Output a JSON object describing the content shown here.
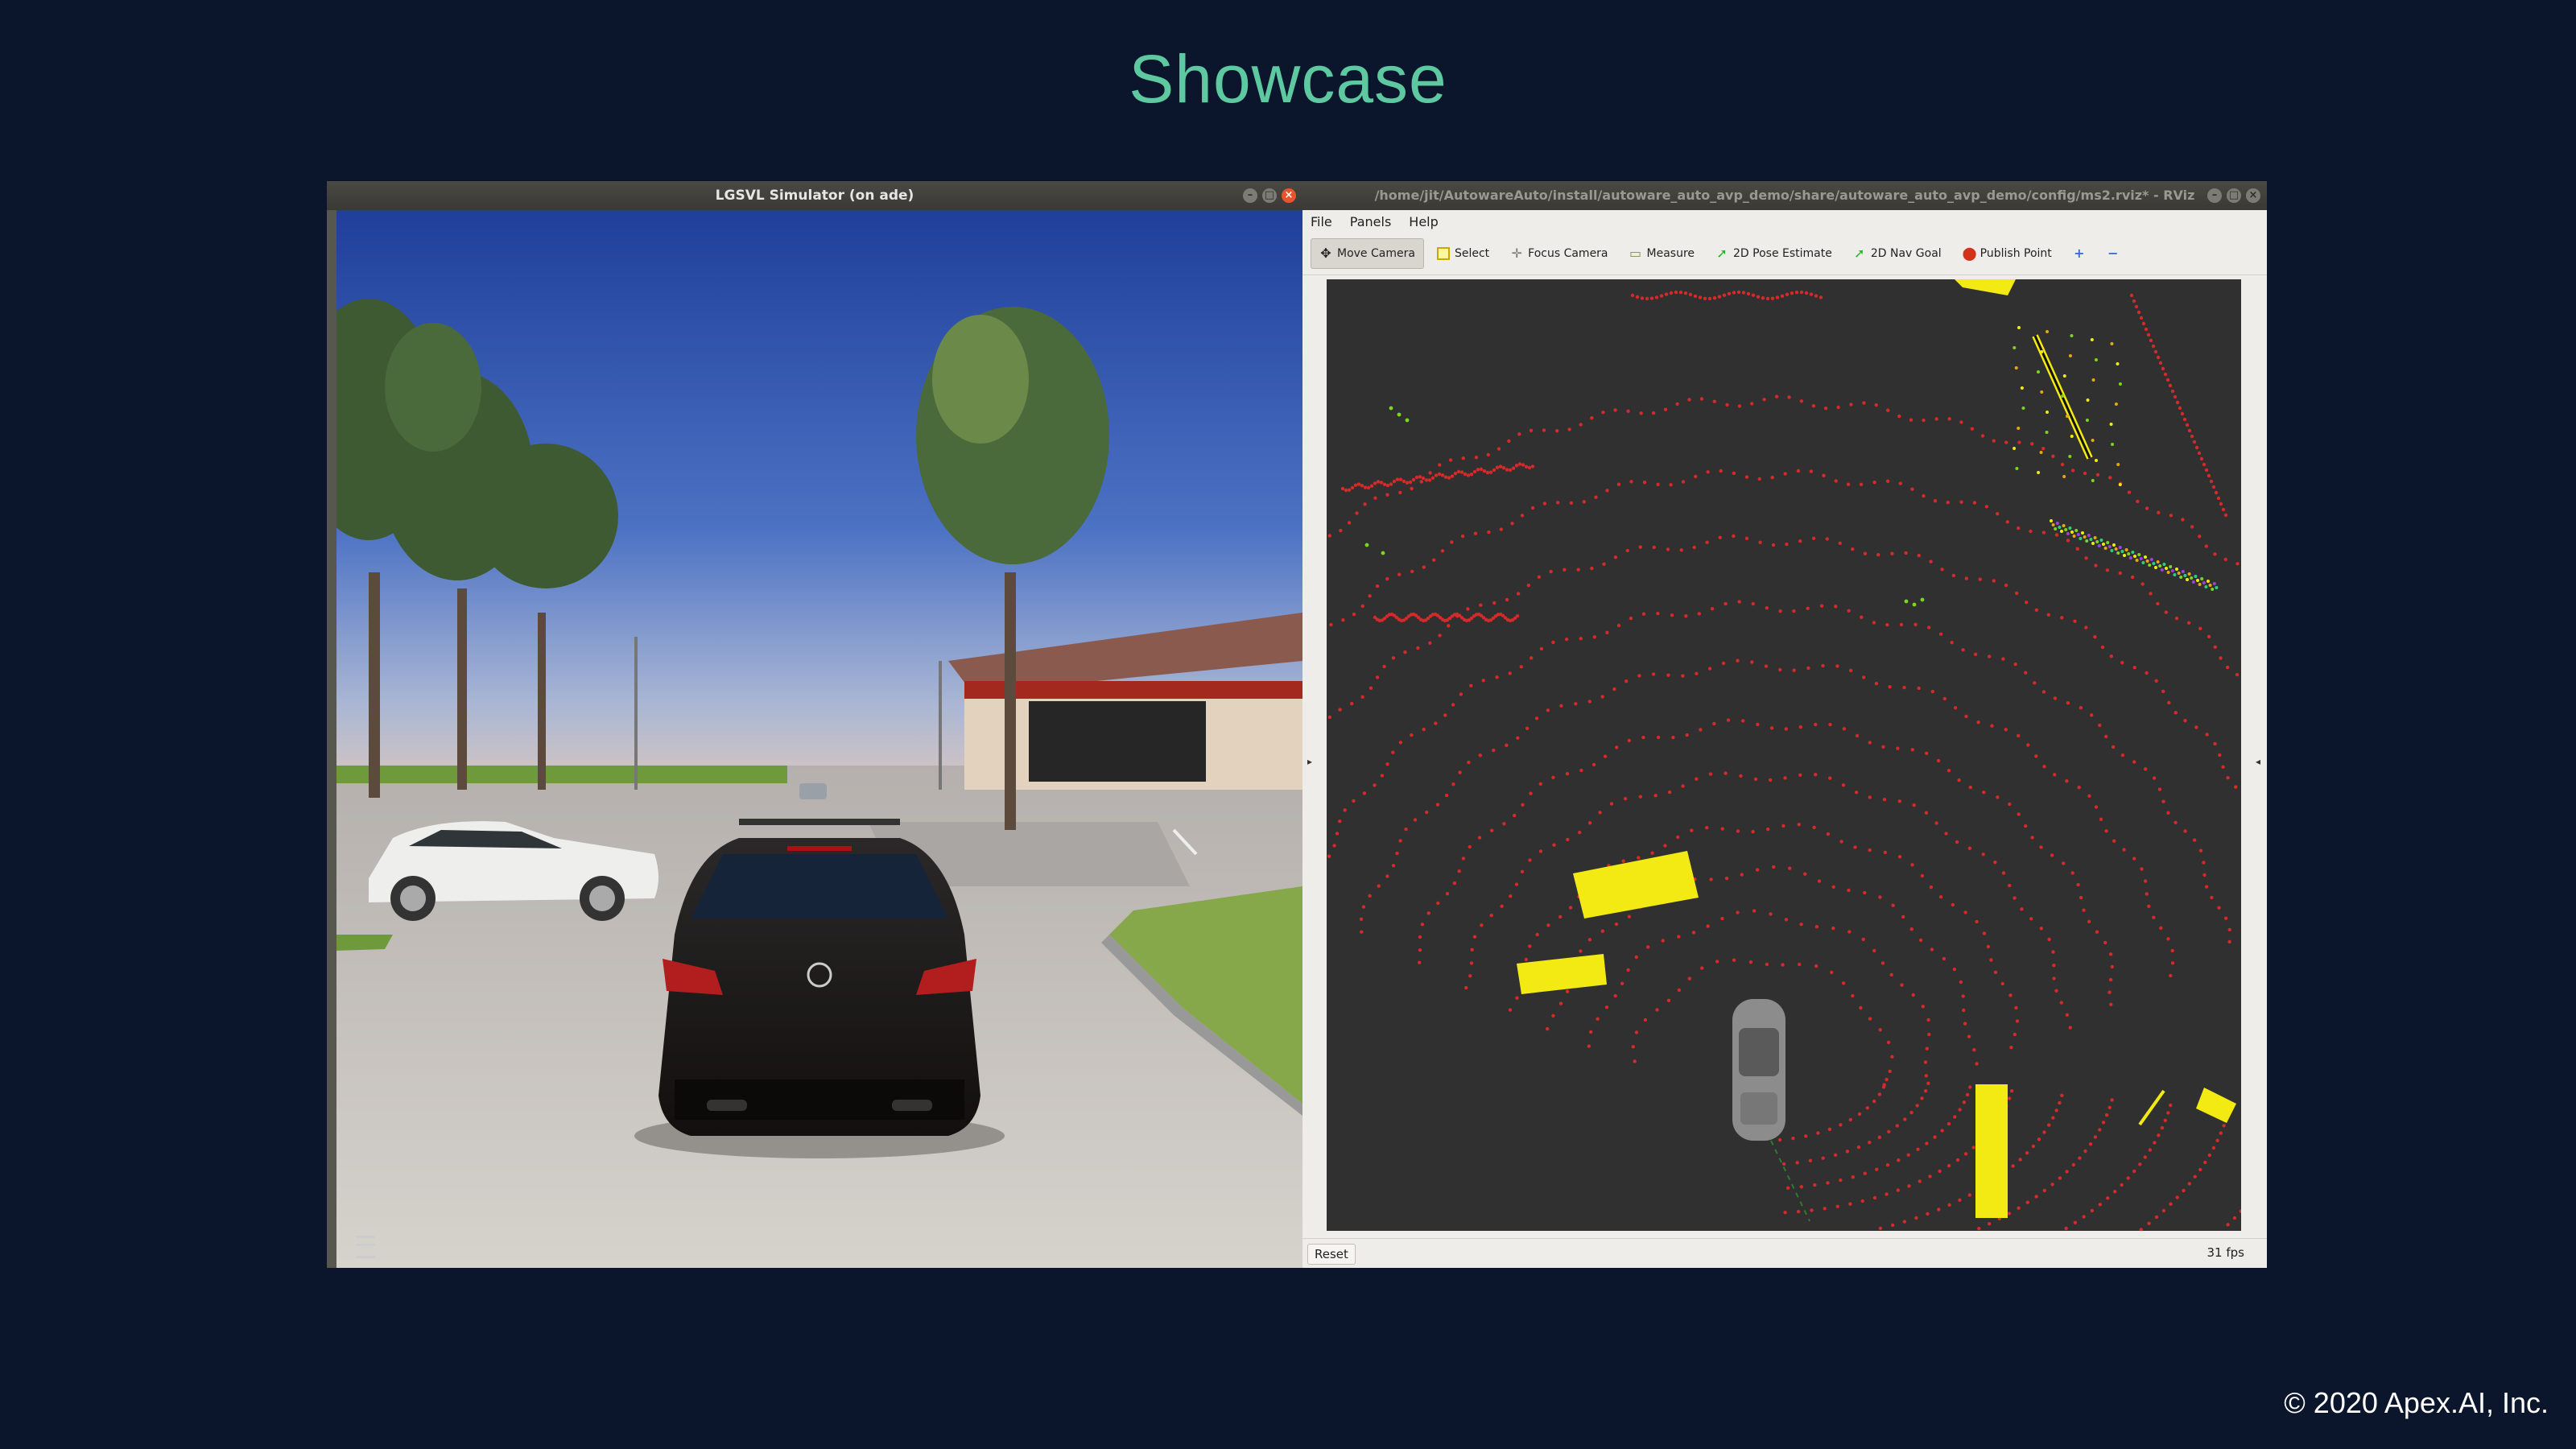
{
  "slide": {
    "title": "Showcase",
    "copyright": "© 2020 Apex.AI, Inc."
  },
  "lgsvl_window": {
    "title": "LGSVL Simulator (on ade)"
  },
  "rviz_window": {
    "title": "/home/jit/AutowareAuto/install/autoware_auto_avp_demo/share/autoware_auto_avp_demo/config/ms2.rviz* - RViz",
    "menu": [
      "File",
      "Panels",
      "Help"
    ],
    "toolbar": [
      {
        "label": "Move Camera",
        "icon": "move-camera-icon"
      },
      {
        "label": "Select",
        "icon": "select-icon"
      },
      {
        "label": "Focus Camera",
        "icon": "focus-camera-icon"
      },
      {
        "label": "Measure",
        "icon": "measure-icon"
      },
      {
        "label": "2D Pose Estimate",
        "icon": "pose-estimate-icon"
      },
      {
        "label": "2D Nav Goal",
        "icon": "nav-goal-icon"
      },
      {
        "label": "Publish Point",
        "icon": "publish-point-icon"
      }
    ],
    "reset_label": "Reset",
    "fps_label": "31 fps"
  },
  "colors": {
    "background": "#0b162c",
    "title": "#5ec8a1",
    "lidar_points": "#d42a2a",
    "detected_objects": "#f2ea12"
  }
}
